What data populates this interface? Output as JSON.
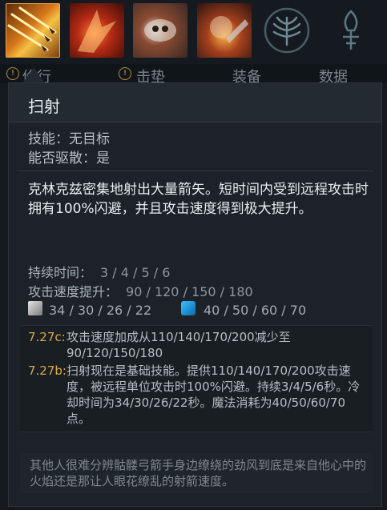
{
  "ability_bar": {
    "abilities": [
      {
        "icon": "strafe-arrows-icon"
      },
      {
        "icon": "searing-arrows-icon"
      },
      {
        "icon": "skeleton-walk-icon"
      },
      {
        "icon": "death-pact-icon"
      }
    ],
    "talents": [
      {
        "icon": "talent-tree-icon"
      },
      {
        "icon": "aghanims-scepter-icon"
      }
    ]
  },
  "tabs": [
    {
      "label": "修行"
    },
    {
      "label": "击垫"
    },
    {
      "label": "装备"
    },
    {
      "label": "数据"
    }
  ],
  "tooltip": {
    "title": "扫射",
    "ability_type": "技能：无目标",
    "dispellable": "能否驱散：是",
    "description": "克林克兹密集地射出大量箭矢。短时间内受到远程攻击时拥有100%闪避，并且攻击速度得到极大提升。",
    "stats": [
      {
        "label": "持续时间：",
        "values": "3 / 4 / 5 / 6"
      },
      {
        "label": "攻击速度提升：",
        "values": "90 / 120 / 150 / 180"
      }
    ],
    "cooldown": "34 / 30 / 26 / 22",
    "mana_cost": "40 / 50 / 60 / 70",
    "notes": [
      {
        "version": "7.27c:",
        "text": "攻击速度加成从110/140/170/200减少至90/120/150/180"
      },
      {
        "version": "7.27b:",
        "text": "扫射现在是基础技能。提供110/140/170/200攻击速度，被远程单位攻击时100%闪避。持续3/4/5/6秒。冷却时间为34/30/26/22秒。魔法消耗为40/50/60/70点。"
      }
    ],
    "lore": "其他人很难分辨骷髅弓箭手身边缭绕的劲风到底是来自他心中的火焰还是那让人眼花缭乱的射箭速度。"
  },
  "colors": {
    "accent": "#d8a84a",
    "mana": "#1e9be0",
    "background": "#1c2227"
  }
}
